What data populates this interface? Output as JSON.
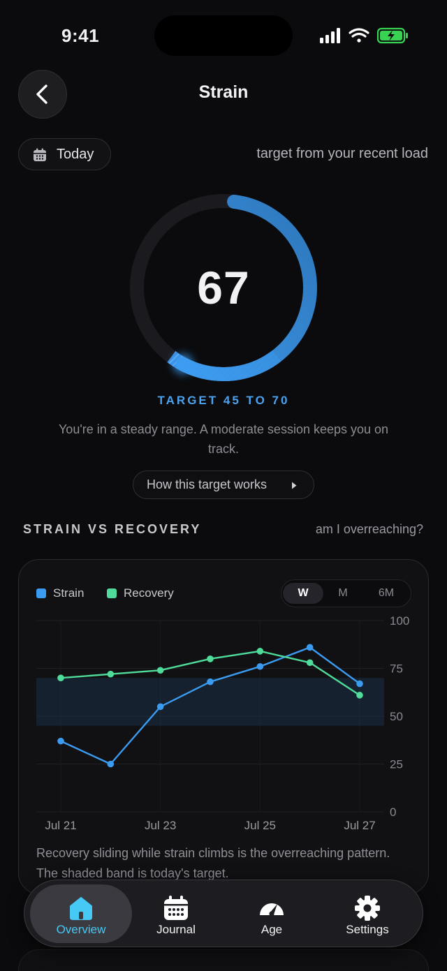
{
  "status": {
    "time": "9:41"
  },
  "header": {
    "title": "Strain"
  },
  "date_filter": {
    "label": "Today",
    "icon": "calendar-icon"
  },
  "target_note": "target from your recent load",
  "ring": {
    "score": "67",
    "score_fraction": 0.67,
    "target_low_fraction": 0.45,
    "target_high_fraction": 0.7,
    "target_label": "TARGET 45 TO 70",
    "message": "You're in a steady range. A moderate session keeps you on track.",
    "how_button": "How this target works",
    "accent": "#3a8fe0"
  },
  "section": {
    "title": "STRAIN VS RECOVERY",
    "link": "am I overreaching?"
  },
  "chart_card": {
    "legend": [
      {
        "label": "Strain",
        "color": "#3b9bf0"
      },
      {
        "label": "Recovery",
        "color": "#4fdc9a"
      }
    ],
    "ranges": [
      "W",
      "M",
      "6M"
    ],
    "selected_range": "W",
    "caption": "Recovery sliding while strain climbs is the overreaching pattern. The shaded band is today's target."
  },
  "chart_data": {
    "type": "line",
    "x": [
      "Jul 21",
      "Jul 22",
      "Jul 23",
      "Jul 24",
      "Jul 25",
      "Jul 26",
      "Jul 27"
    ],
    "x_tick_labels": [
      "Jul 21",
      "Jul 23",
      "Jul 25",
      "Jul 27"
    ],
    "series": [
      {
        "name": "Strain",
        "color": "#3b9bf0",
        "values": [
          37,
          25,
          55,
          68,
          76,
          86,
          67
        ]
      },
      {
        "name": "Recovery",
        "color": "#4fdc9a",
        "values": [
          70,
          72,
          74,
          80,
          84,
          78,
          61
        ]
      }
    ],
    "target_band": [
      45,
      70
    ],
    "ylim": [
      0,
      100
    ],
    "y_ticks": [
      100,
      75,
      50,
      25,
      0
    ],
    "grid": true,
    "legend": "top-left"
  },
  "tabs": [
    {
      "label": "Overview",
      "icon": "home-icon",
      "active": true
    },
    {
      "label": "Journal",
      "icon": "calendar-icon",
      "active": false
    },
    {
      "label": "Age",
      "icon": "gauge-icon",
      "active": false
    },
    {
      "label": "Settings",
      "icon": "gear-icon",
      "active": false
    }
  ]
}
